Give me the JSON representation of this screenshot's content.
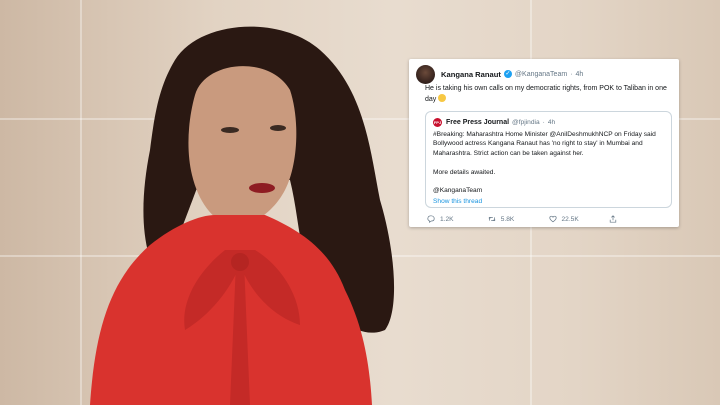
{
  "tweet": {
    "author_name": "Kangana Ranaut",
    "author_handle": "@KanganaTeam",
    "time": "4h",
    "text": "He is taking his own calls on my democratic rights, from POK to Taliban in one day",
    "quoted": {
      "logo_text": "FPJ",
      "author_name": "Free Press Journal",
      "author_handle": "@fpjindia",
      "time": "4h",
      "line1": "#Breaking:  Maharashtra Home Minister @AnilDeshmukhNCP on Friday said Bollywood actress Kangana Ranaut has 'no right to stay' in Mumbai and Maharashtra. Strict action can be taken against her.",
      "line2": "More details awaited.",
      "line3": "@KanganaTeam",
      "show_thread": "Show this thread"
    },
    "actions": {
      "replies": "1.2K",
      "retweets": "5.8K",
      "likes": "22.5K"
    }
  },
  "colors": {
    "verified": "#1da1f2",
    "link": "#1b95e0",
    "muted": "#657786",
    "dress": "#d9332e"
  }
}
